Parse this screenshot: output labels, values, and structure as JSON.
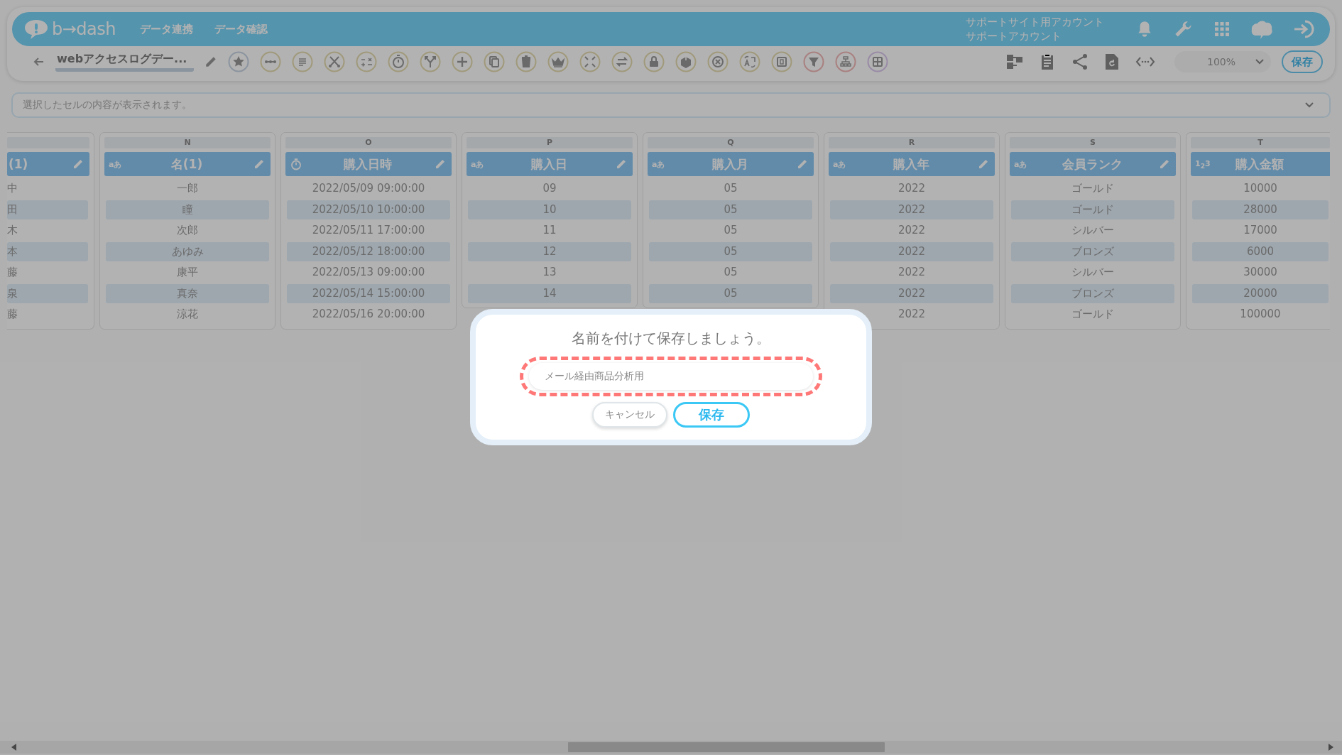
{
  "header": {
    "logo": "b→dash",
    "nav": [
      "データ連携",
      "データ確認"
    ],
    "account": [
      "サポートサイト用アカウント",
      "サポートアカウント"
    ]
  },
  "toolbar": {
    "title": "webアクセスログデー...",
    "zoom": "100%",
    "save": "保存"
  },
  "formula_bar": {
    "placeholder": "選択したセルの内容が表示されます。"
  },
  "columns": [
    {
      "kind": "text",
      "title": "(1)",
      "pencil": true,
      "cells": [
        "中",
        "田",
        "木",
        "本",
        "藤",
        "泉",
        "藤"
      ]
    },
    {
      "letter": "N",
      "kind": "text",
      "badge": "aあ",
      "title": "名(1)",
      "pencil": true,
      "cells": [
        "一郎",
        "瞳",
        "次郎",
        "あゆみ",
        "康平",
        "真奈",
        "涼花"
      ]
    },
    {
      "letter": "O",
      "kind": "datetime",
      "title": "購入日時",
      "pencil": true,
      "cells": [
        "2022/05/09 09:00:00",
        "2022/05/10 10:00:00",
        "2022/05/11 17:00:00",
        "2022/05/12 18:00:00",
        "2022/05/13 09:00:00",
        "2022/05/14 15:00:00",
        "2022/05/16 20:00:00"
      ]
    },
    {
      "letter": "P",
      "kind": "text",
      "badge": "aあ",
      "title": "購入日",
      "pencil": true,
      "cells": [
        "09",
        "10",
        "11",
        "12",
        "13",
        "14"
      ]
    },
    {
      "letter": "Q",
      "kind": "text",
      "badge": "aあ",
      "title": "購入月",
      "pencil": true,
      "cells": [
        "05",
        "05",
        "05",
        "05",
        "05",
        "05"
      ]
    },
    {
      "letter": "R",
      "kind": "text",
      "badge": "aあ",
      "title": "購入年",
      "pencil": true,
      "cells": [
        "2022",
        "2022",
        "2022",
        "2022",
        "2022",
        "2022",
        "2022"
      ]
    },
    {
      "letter": "S",
      "kind": "text",
      "badge": "aあ",
      "title": "会員ランク",
      "pencil": true,
      "cells": [
        "ゴールド",
        "ゴールド",
        "シルバー",
        "ブロンズ",
        "シルバー",
        "ブロンズ",
        "ゴールド"
      ]
    },
    {
      "letter": "T",
      "kind": "number",
      "badge": "1$_{2}$3",
      "title": "購入金額",
      "cells": [
        "10000",
        "28000",
        "17000",
        "6000",
        "30000",
        "20000",
        "100000"
      ]
    }
  ],
  "dialog": {
    "title": "名前を付けて保存しましょう。",
    "name_field": {
      "value": "メール経由商品分析用",
      "highlighted": true
    },
    "buttons": [
      {
        "label": "キャンセル",
        "kind": "secondary"
      },
      {
        "label": "保存",
        "kind": "primary"
      }
    ]
  }
}
